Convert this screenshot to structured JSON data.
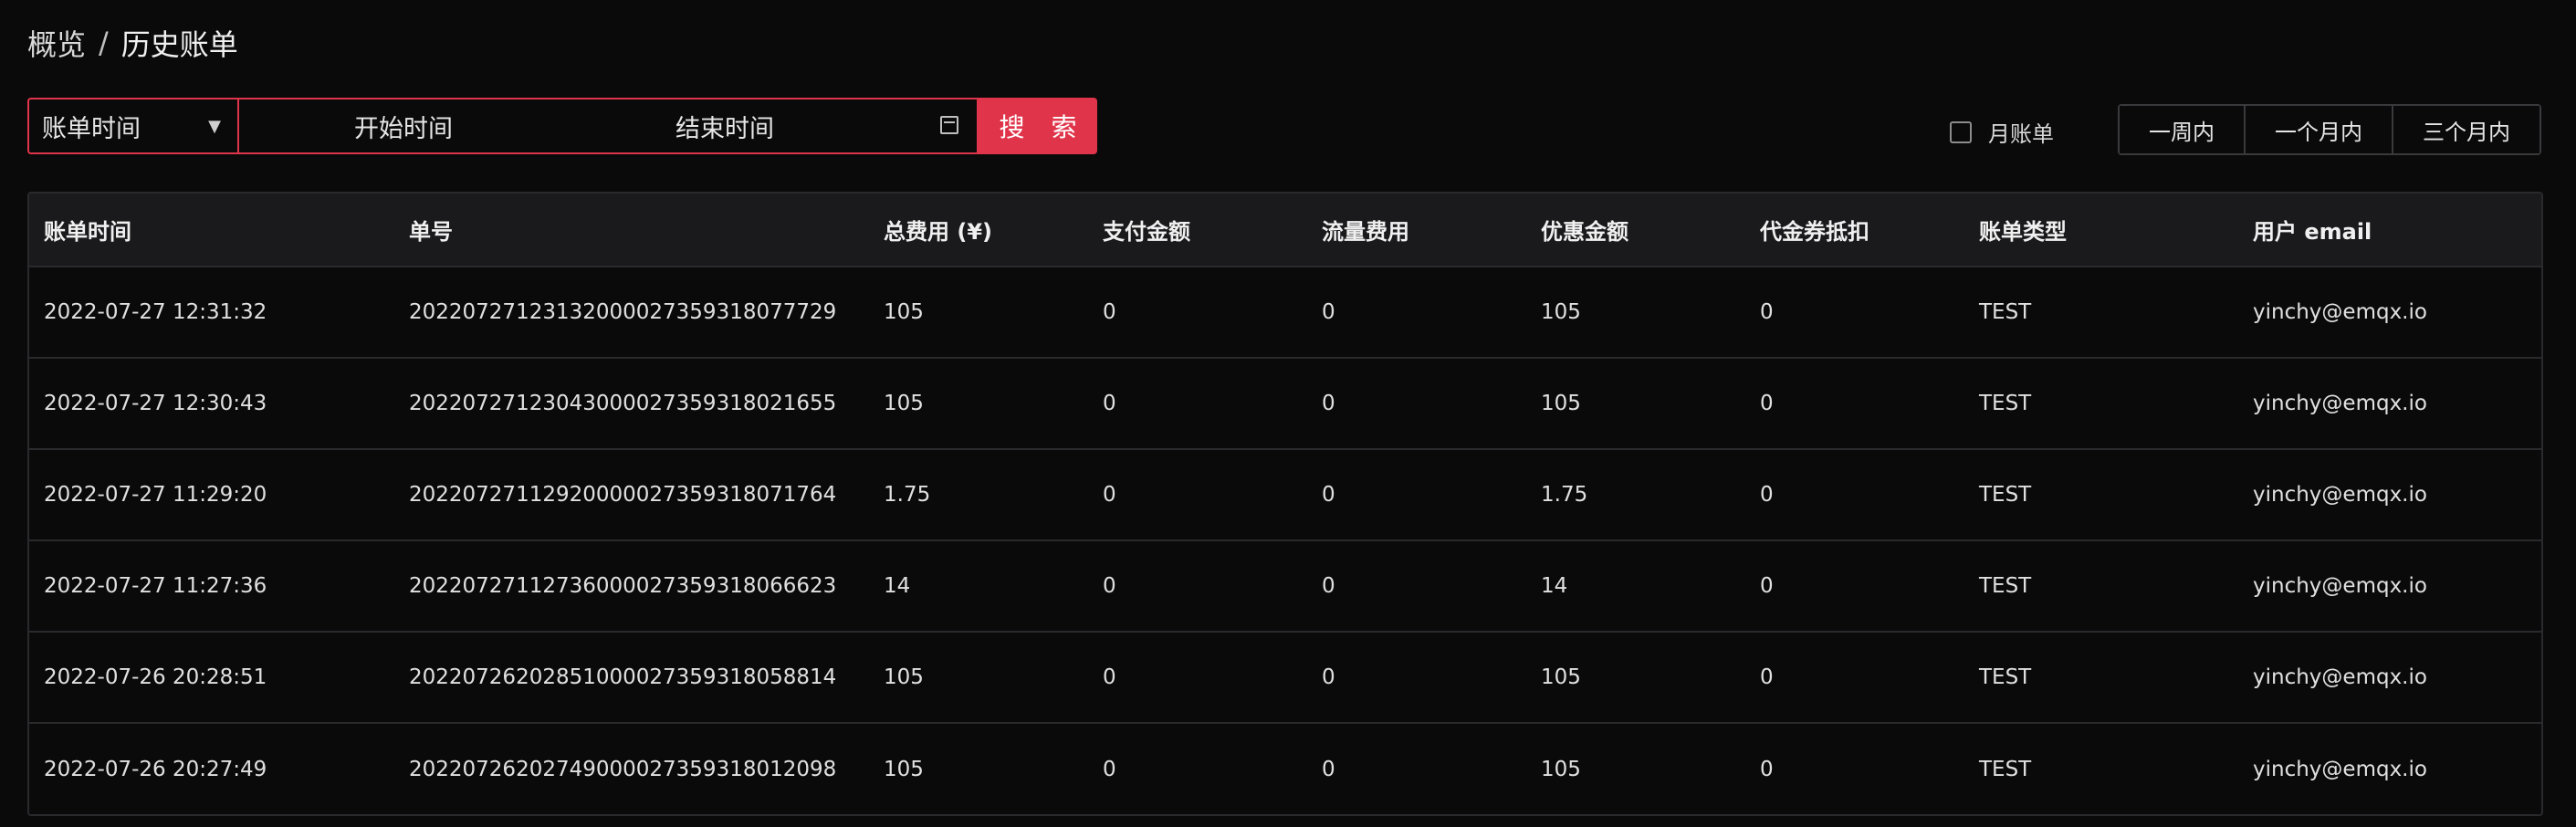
{
  "breadcrumb": {
    "root": "概览",
    "separator": "/",
    "current": "历史账单"
  },
  "filter": {
    "select_value": "账单时间",
    "start_placeholder": "开始时间",
    "end_placeholder": "结束时间",
    "search_label": "搜 索",
    "month_bill_label": "月账单",
    "month_bill_checked": false,
    "ranges": [
      "一周内",
      "一个月内",
      "三个月内"
    ]
  },
  "colors": {
    "accent": "#e0344a",
    "background": "#0a0a0b",
    "header_bg": "#1a1a1c"
  },
  "table": {
    "columns": [
      "账单时间",
      "单号",
      "总费用 (¥)",
      "支付金额",
      "流量费用",
      "优惠金额",
      "代金券抵扣",
      "账单类型",
      "用户 email"
    ],
    "rows": [
      [
        "2022-07-27 12:31:32",
        "20220727123132000027359318077729",
        "105",
        "0",
        "0",
        "105",
        "0",
        "TEST",
        "yinchy@emqx.io"
      ],
      [
        "2022-07-27 12:30:43",
        "20220727123043000027359318021655",
        "105",
        "0",
        "0",
        "105",
        "0",
        "TEST",
        "yinchy@emqx.io"
      ],
      [
        "2022-07-27 11:29:20",
        "20220727112920000027359318071764",
        "1.75",
        "0",
        "0",
        "1.75",
        "0",
        "TEST",
        "yinchy@emqx.io"
      ],
      [
        "2022-07-27 11:27:36",
        "20220727112736000027359318066623",
        "14",
        "0",
        "0",
        "14",
        "0",
        "TEST",
        "yinchy@emqx.io"
      ],
      [
        "2022-07-26 20:28:51",
        "20220726202851000027359318058814",
        "105",
        "0",
        "0",
        "105",
        "0",
        "TEST",
        "yinchy@emqx.io"
      ],
      [
        "2022-07-26 20:27:49",
        "20220726202749000027359318012098",
        "105",
        "0",
        "0",
        "105",
        "0",
        "TEST",
        "yinchy@emqx.io"
      ]
    ]
  }
}
